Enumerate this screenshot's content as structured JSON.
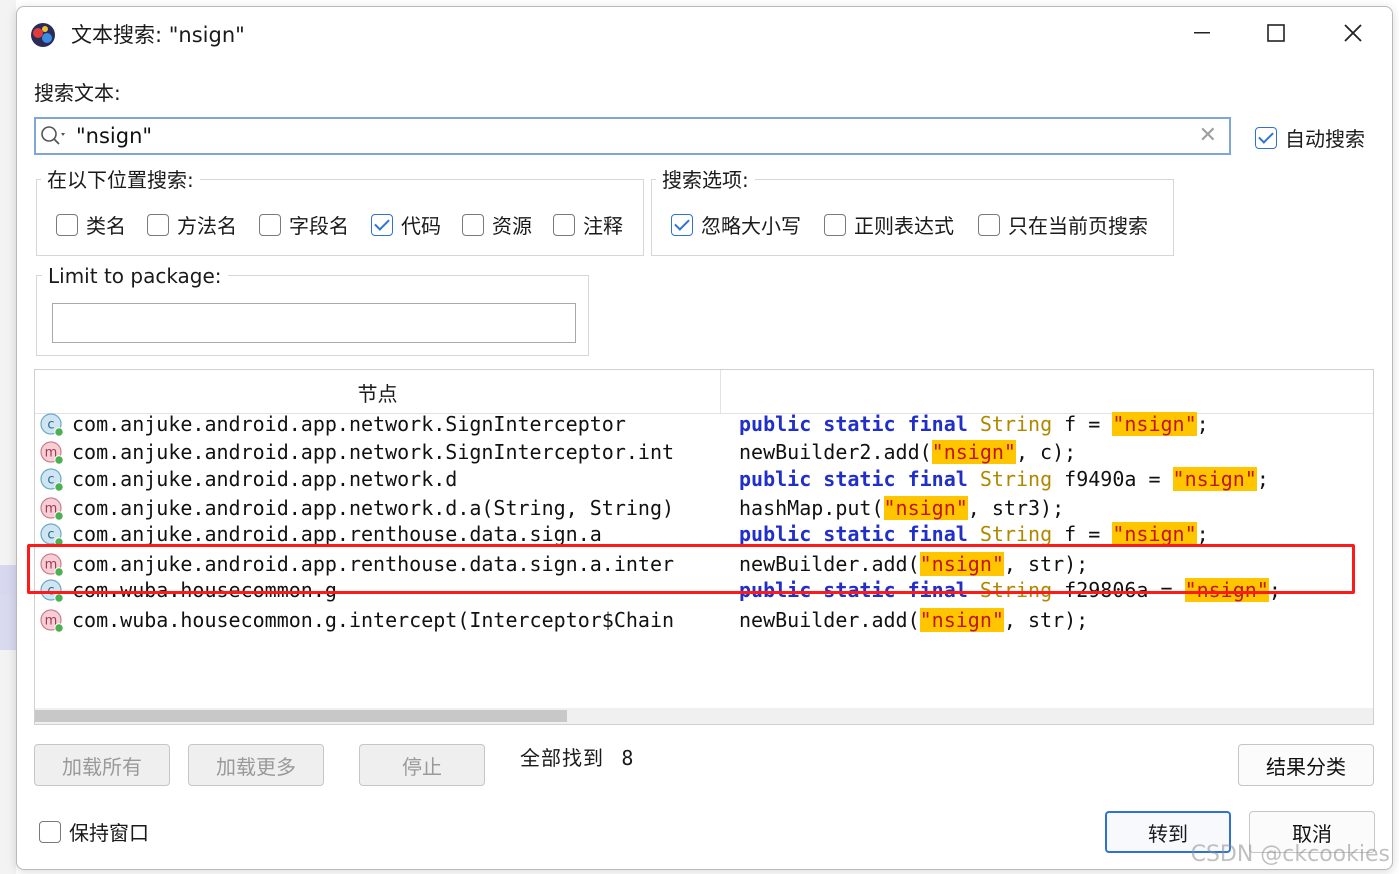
{
  "window": {
    "title": "文本搜索: \"nsign\""
  },
  "search": {
    "label": "搜索文本:",
    "value": "\"nsign\"",
    "auto_search_label": "自动搜索",
    "auto_search_checked": true
  },
  "location": {
    "title": "在以下位置搜索:",
    "options": [
      {
        "label": "类名",
        "checked": false
      },
      {
        "label": "方法名",
        "checked": false
      },
      {
        "label": "字段名",
        "checked": false
      },
      {
        "label": "代码",
        "checked": true
      },
      {
        "label": "资源",
        "checked": false
      },
      {
        "label": "注释",
        "checked": false
      }
    ]
  },
  "search_options": {
    "title": "搜索选项:",
    "options": [
      {
        "label": "忽略大小写",
        "checked": true
      },
      {
        "label": "正则表达式",
        "checked": false
      },
      {
        "label": "只在当前页搜索",
        "checked": false
      }
    ]
  },
  "package": {
    "label": "Limit to package:",
    "value": ""
  },
  "results": {
    "node_header": "节点",
    "rows": [
      {
        "icon": "class",
        "node": "com.anjuke.android.app.network.SignInterceptor",
        "code": "public static final String f = \"nsign\";"
      },
      {
        "icon": "method",
        "node": "com.anjuke.android.app.network.SignInterceptor.int",
        "code": "newBuilder2.add(\"nsign\", c);"
      },
      {
        "icon": "class",
        "node": "com.anjuke.android.app.network.d",
        "code": "public static final String f9490a = \"nsign\";"
      },
      {
        "icon": "method",
        "node": "com.anjuke.android.app.network.d.a(String, String)",
        "code": "hashMap.put(\"nsign\", str3);"
      },
      {
        "icon": "class",
        "node": "com.anjuke.android.app.renthouse.data.sign.a",
        "code": "public static final String f = \"nsign\";"
      },
      {
        "icon": "method",
        "node": "com.anjuke.android.app.renthouse.data.sign.a.inter",
        "code": "newBuilder.add(\"nsign\", str);"
      },
      {
        "icon": "class",
        "node": "com.wuba.housecommon.g",
        "code": "public static final String f29806a = \"nsign\";"
      },
      {
        "icon": "method",
        "node": "com.wuba.housecommon.g.intercept(Interceptor$Chain",
        "code": "newBuilder.add(\"nsign\", str);"
      }
    ]
  },
  "footer": {
    "load_all": "加载所有",
    "load_more": "加载更多",
    "stop": "停止",
    "found_label": "全部找到",
    "found_count": "8",
    "group_results": "结果分类",
    "keep_window_label": "保持窗口",
    "keep_window_checked": false,
    "goto": "转到",
    "cancel": "取消"
  },
  "watermark": "CSDN @ckcookies",
  "colors": {
    "accent": "#2f72d3",
    "highlight_bg": "#ffc600",
    "highlight_text": "#c11515",
    "keyword": "#1f2fc8",
    "type": "#b08800",
    "annotation_box": "#ff1a1a"
  }
}
